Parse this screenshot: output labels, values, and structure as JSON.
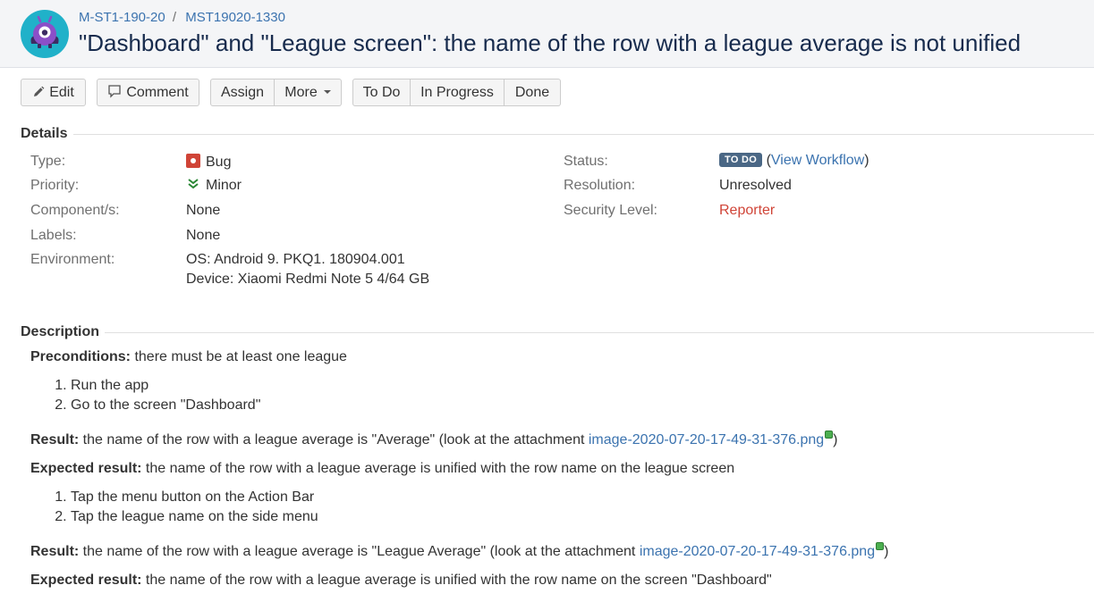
{
  "breadcrumb": {
    "project": "M-ST1-190-20",
    "separator": "/",
    "issue_key": "MST19020-1330"
  },
  "issue": {
    "title": "\"Dashboard\" and \"League screen\": the name of the row with a league average is not unified"
  },
  "toolbar": {
    "edit": "Edit",
    "comment": "Comment",
    "assign": "Assign",
    "more": "More",
    "todo": "To Do",
    "in_progress": "In Progress",
    "done": "Done"
  },
  "details": {
    "heading": "Details",
    "type_label": "Type:",
    "type_value": "Bug",
    "priority_label": "Priority:",
    "priority_value": "Minor",
    "components_label": "Component/s:",
    "components_value": "None",
    "labels_label": "Labels:",
    "labels_value": "None",
    "environment_label": "Environment:",
    "environment_line1": "OS: Android 9. PKQ1. 180904.001",
    "environment_line2": "Device: Xiaomi Redmi Note 5 4/64 GB",
    "status_label": "Status:",
    "status_value": "TO DO",
    "workflow_open": "(",
    "workflow_link": "View Workflow",
    "workflow_close": ")",
    "resolution_label": "Resolution:",
    "resolution_value": "Unresolved",
    "security_label": "Security Level:",
    "security_value": "Reporter"
  },
  "description": {
    "heading": "Description",
    "preconditions_label": "Preconditions:",
    "preconditions_text": " there must be at least one league",
    "steps1": [
      "Run the app",
      "Go to the screen \"Dashboard\""
    ],
    "result1_label": "Result:",
    "result1_text": " the name of the row with a league average is \"Average\" (look at the attachment ",
    "result1_link": "image-2020-07-20-17-49-31-376.png",
    "result1_end": ")",
    "expected1_label": "Expected result:",
    "expected1_text": " the name of the row with a league average is unified with the row name on the league screen",
    "steps2": [
      "Tap the menu button on the Action Bar",
      "Tap the league name on the side menu"
    ],
    "result2_label": "Result:",
    "result2_text": " the name of the row with a league average is \"League Average\" (look at the attachment ",
    "result2_link": "image-2020-07-20-17-49-31-376.png",
    "result2_end": ")",
    "expected2_label": "Expected result:",
    "expected2_text": " the name of the row with a league average is unified with the row name on the screen \"Dashboard\""
  },
  "colors": {
    "link": "#3b73af",
    "lozenge": "#4a6785",
    "bug": "#d04437",
    "priority": "#2a8735"
  },
  "icons": {
    "avatar": "project-avatar-icon",
    "edit": "pencil-icon",
    "comment": "speech-bubble-icon",
    "type": "bug-icon",
    "priority": "double-chevron-down-icon",
    "attachment": "attachment-icon"
  }
}
